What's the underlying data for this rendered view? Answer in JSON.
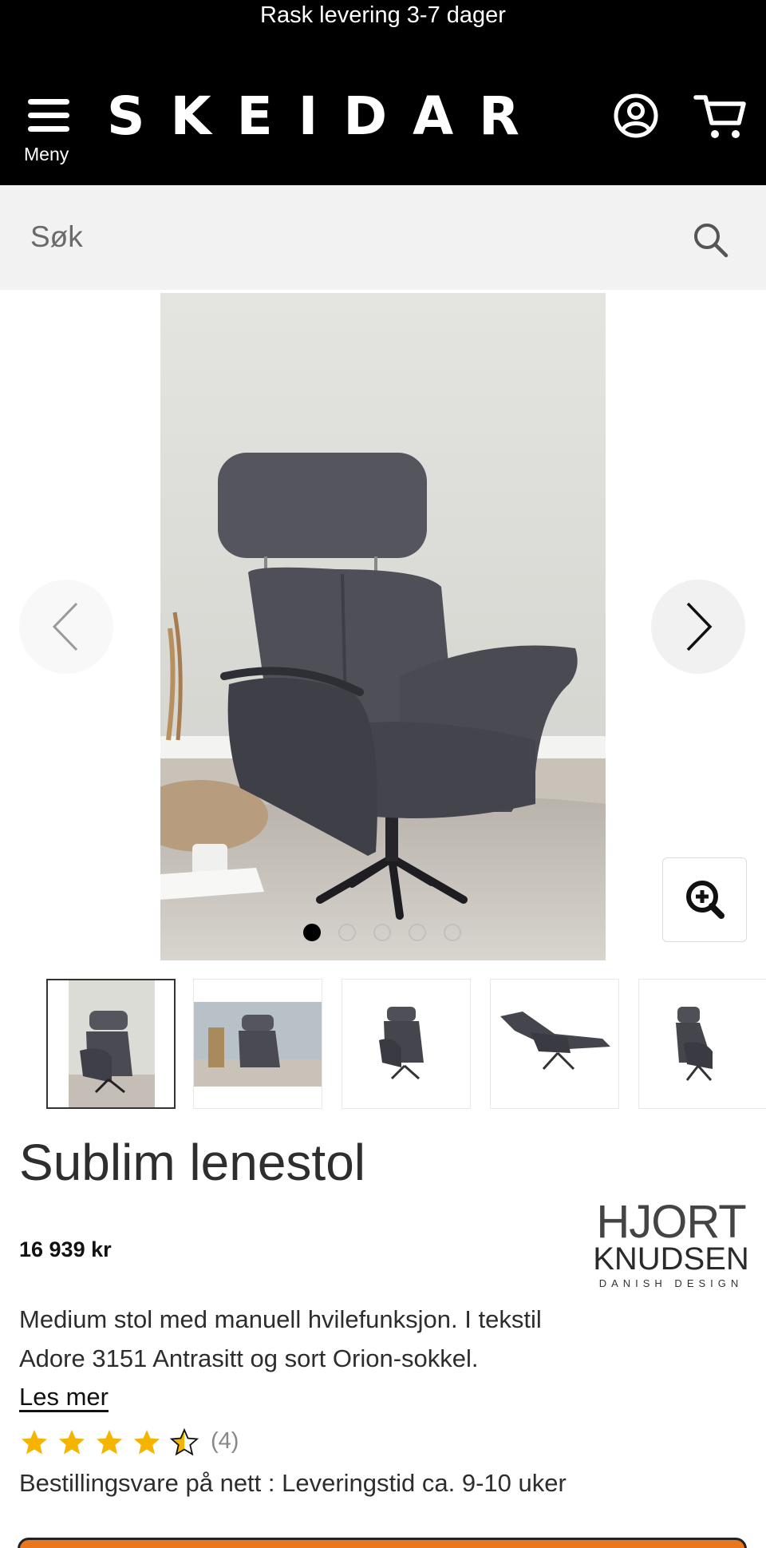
{
  "header": {
    "promo_text": "Rask levering 3-7 dager",
    "menu_label": "Meny",
    "logo_text": "SKEIDAR",
    "account_icon": "user-circle-icon",
    "cart_icon": "cart-icon",
    "background": "#000000"
  },
  "search": {
    "placeholder": "Søk",
    "icon": "search-icon"
  },
  "gallery": {
    "image_count": 5,
    "active_index": 0,
    "prev_icon": "chevron-left-icon",
    "next_icon": "chevron-right-icon",
    "zoom_icon": "zoom-in-icon"
  },
  "product": {
    "title": "Sublim lenestol",
    "price": "16 939 kr",
    "brand": {
      "line1": "HJORT",
      "line2": "KNUDSEN",
      "tagline": "DANISH DESIGN"
    },
    "description_line1": "Medium stol med manuell hvilefunksjon. I tekstil",
    "description_line2": "Adore 3151 Antrasitt og sort Orion-sokkel.",
    "read_more": "Les mer",
    "rating": 4.5,
    "rating_max": 5,
    "review_count": "(4)",
    "availability": "Bestillingsvare på nett : Leveringstid ca. 9-10 uker"
  },
  "colors": {
    "star": "#f5b400",
    "cta": "#e8771e",
    "chair": "#4a4a52"
  }
}
